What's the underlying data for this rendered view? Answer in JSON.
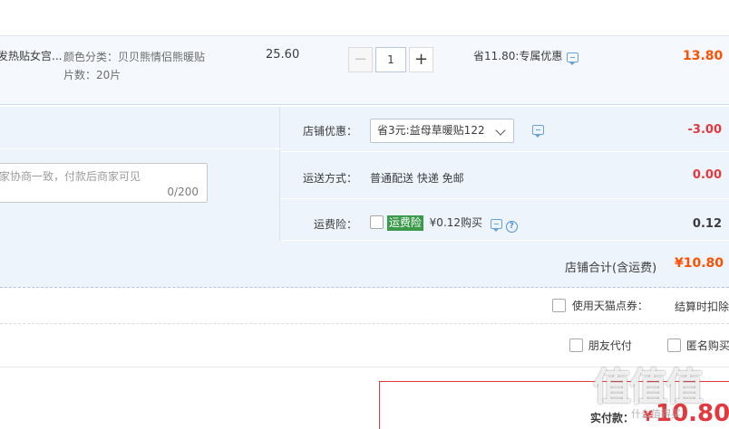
{
  "item": {
    "name": "发热贴女宫...",
    "spec_line1": "颜色分类：贝贝熊情侣熊暖贴",
    "spec_line2": "片数：20片",
    "unit_price": "25.60",
    "quantity": "1",
    "minus": "−",
    "plus": "+",
    "promo": "省11.80:专属优惠",
    "total": "13.80"
  },
  "message": {
    "placeholder": "家协商一致，付款后商家可见",
    "count": "0/200"
  },
  "shop": {
    "coupon_label": "店铺优惠：",
    "coupon_selected": "省3元:益母草暖贴122",
    "coupon_amount": "-3.00",
    "shipping_label": "运送方式：",
    "shipping_value": "普通配送 快递 免邮",
    "shipping_amount": "0.00",
    "insurance_label": "运费险：",
    "insurance_badge": "运费险",
    "insurance_price": "¥0.12购买",
    "insurance_amount": "0.12",
    "total_label": "店铺合计(含运费)",
    "total_amount": "¥10.80"
  },
  "options": {
    "tmall_points": "使用天猫点券：",
    "settle_deduct": "结算时扣除",
    "friend_pay": "朋友代付",
    "anonymous": "匿名购买"
  },
  "payment": {
    "label": "实付款：",
    "currency": "¥",
    "amount": "10.80"
  },
  "watermark": {
    "logo": "值值值",
    "site": "什么值得买"
  },
  "colors": {
    "accent_orange": "#ff5000",
    "pay_red": "#e4393c",
    "row_bg": "#f5f8fc",
    "box_bg": "#eef4fc",
    "insurance_green": "#3a9a4a"
  }
}
